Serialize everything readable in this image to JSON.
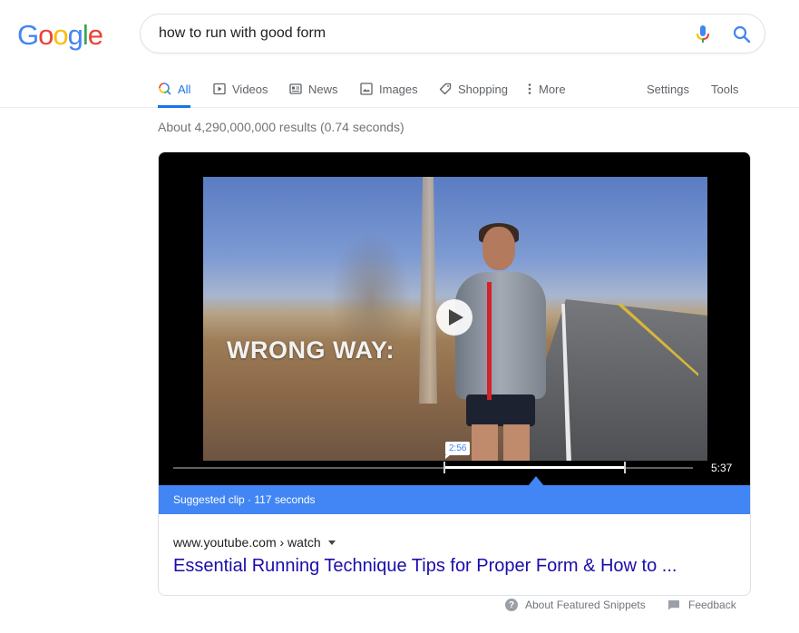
{
  "logo": {
    "letters": [
      "G",
      "o",
      "o",
      "g",
      "l",
      "e"
    ],
    "colors": [
      "#4285f4",
      "#ea4335",
      "#fbbc05",
      "#4285f4",
      "#34a853",
      "#ea4335"
    ]
  },
  "search": {
    "query": "how to run with good form",
    "mic_icon": "microphone-icon",
    "search_icon": "search-icon"
  },
  "tabs": [
    {
      "label": "All",
      "icon": "search-multicolor-icon",
      "active": true
    },
    {
      "label": "Videos",
      "icon": "play-box-icon"
    },
    {
      "label": "News",
      "icon": "newspaper-icon"
    },
    {
      "label": "Images",
      "icon": "image-icon"
    },
    {
      "label": "Shopping",
      "icon": "tag-icon"
    },
    {
      "label": "More",
      "icon": "vertical-dots-icon"
    }
  ],
  "tools": {
    "settings": "Settings",
    "tools": "Tools"
  },
  "stats": "About 4,290,000,000 results (0.74 seconds)",
  "video": {
    "overlay_text": "WRONG WAY:",
    "clip_start": "2:56",
    "duration": "5:37",
    "clip_start_fraction": 0.522,
    "clip_end_fraction": 0.869,
    "suggested_clip": "Suggested clip · 117 seconds"
  },
  "result": {
    "cite": "www.youtube.com › watch",
    "title": "Essential Running Technique Tips for Proper Form & How to ..."
  },
  "footer": {
    "about": "About Featured Snippets",
    "feedback": "Feedback"
  },
  "colors": {
    "accent": "#1a73e8",
    "clip_bar": "#4285f4",
    "link": "#1a0dab"
  }
}
